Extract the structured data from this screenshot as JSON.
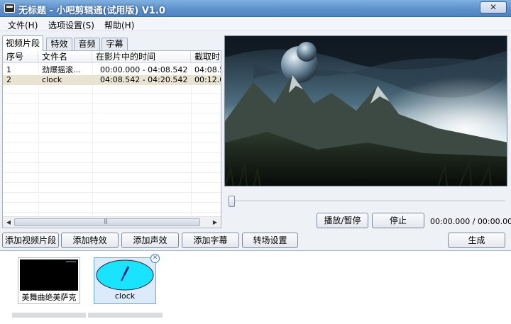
{
  "window": {
    "title": "无标题 - 小吧剪辑通(试用版) V1.0",
    "close_glyph": "✕"
  },
  "menu": [
    "文件(H)",
    "选项设置(S)",
    "帮助(H)"
  ],
  "tabs": [
    "视频片段",
    "特效",
    "音频",
    "字幕"
  ],
  "table": {
    "headers": [
      "序号",
      "文件名",
      "在影片中的时间",
      "截取时"
    ],
    "rows": [
      {
        "index": "1",
        "name": "劲爆摇滚...",
        "time": "00:00.000 - 04:08.542",
        "clip": "04:08.5"
      },
      {
        "index": "2",
        "name": "clock",
        "time": "04:08.542 - 04:20.542",
        "clip": "00:12.0"
      }
    ],
    "selected_row": 2
  },
  "player": {
    "play_pause": "播放/暂停",
    "stop": "停止",
    "time": "00:00.000 / 00:00.000",
    "position": 0
  },
  "actions": {
    "add_clip": "添加视频片段",
    "add_effect": "添加特效",
    "add_sound": "添加声效",
    "add_subtitle": "添加字幕",
    "transition": "转场设置",
    "generate": "生成"
  },
  "timeline": [
    {
      "label": "美舞曲绝美萨克",
      "thumb": "black"
    },
    {
      "label": "clock",
      "thumb": "clock",
      "selected": true
    }
  ],
  "colors": {
    "title_bar": "#5b8fca",
    "selection": "#e9e3d2",
    "clip_selected": "#dcebfb",
    "clock_face": "#19e3ff"
  }
}
